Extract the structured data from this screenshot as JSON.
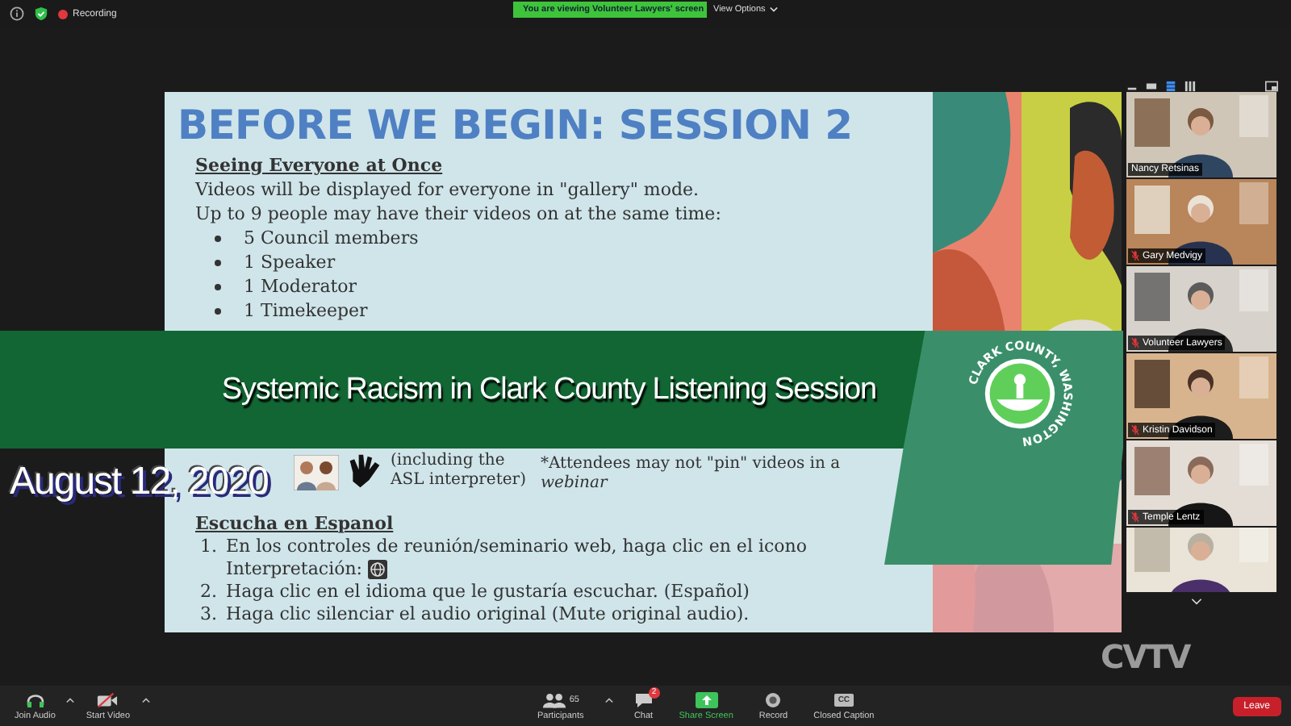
{
  "top_bar": {
    "recording_label": "Recording",
    "viewing_banner": "You are viewing Volunteer Lawyers' screen",
    "view_options": "View Options"
  },
  "slide": {
    "title": "BEFORE WE BEGIN: SESSION 2",
    "heading_1": "Seeing Everyone at Once",
    "lines": [
      "Videos will be displayed for everyone in \"gallery\" mode.",
      "Up to 9 people may have their videos on at the same time:"
    ],
    "bullets": [
      "5 Council members",
      "1 Speaker",
      "1 Moderator",
      "1 Timekeeper"
    ],
    "interpreter_lines": [
      "(including the",
      "ASL interpreter)"
    ],
    "note": "*Attendees may not \"pin\" videos in a",
    "note_emphasis": "webinar",
    "heading_2": "Escucha en Espanol",
    "steps": [
      {
        "number": "1.",
        "text": "En los controles de reunión/seminario web, haga clic en el icono",
        "continuation": "Interpretación:"
      },
      {
        "number": "2.",
        "text": "Haga clic en el idioma que le gustaría escuchar. (Español)"
      },
      {
        "number": "3.",
        "text": "Haga clic silenciar el audio original (Mute original audio)."
      }
    ]
  },
  "overlay": {
    "title": "Systemic Racism in Clark County Listening Session",
    "date": "August 12, 2020",
    "logo_text": "CLARK COUNTY, WASHINGTON"
  },
  "gallery": {
    "participants": [
      {
        "name": "Nancy Retsinas",
        "muted": false
      },
      {
        "name": "Gary Medvigy",
        "muted": true
      },
      {
        "name": "Volunteer Lawyers",
        "muted": true
      },
      {
        "name": "Kristin Davidson",
        "muted": true
      },
      {
        "name": "Temple Lentz",
        "muted": true
      },
      {
        "kind": "partial"
      }
    ]
  },
  "station_logo": "CVTV",
  "toolbar": {
    "items": [
      {
        "kind": "audio",
        "label": "Join Audio"
      },
      {
        "kind": "video",
        "label": "Start Video"
      },
      {
        "kind": "participants",
        "label": "Participants",
        "count": "65"
      },
      {
        "kind": "chat",
        "label": "Chat",
        "badge": "2"
      },
      {
        "kind": "share",
        "label": "Share Screen"
      },
      {
        "kind": "record",
        "label": "Record"
      },
      {
        "kind": "cc",
        "label": "Closed Caption",
        "icon_text": "CC"
      }
    ],
    "leave": "Leave"
  }
}
